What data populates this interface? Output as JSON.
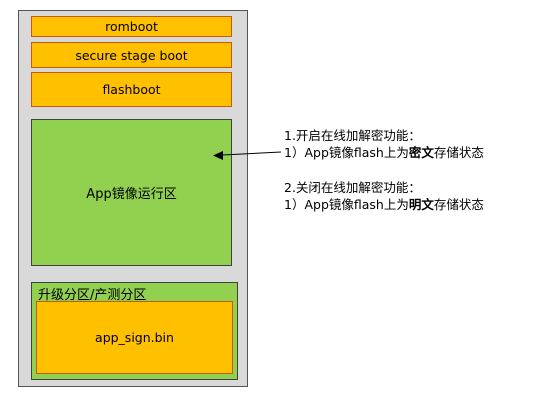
{
  "flash_layout": {
    "romboot": "romboot",
    "secure_stage_boot": "secure stage boot",
    "flashboot": "flashboot",
    "app_region": "App镜像运行区",
    "upgrade_region": "升级分区/产测分区",
    "app_sign": "app_sign.bin"
  },
  "notes": [
    {
      "title": "1.开启在线加解密功能：",
      "detail_prefix": "1）App镜像flash上为",
      "detail_emphasis": "密文",
      "detail_suffix": "存储状态"
    },
    {
      "title": "2.关闭在线加解密功能：",
      "detail_prefix": "1）App镜像flash上为",
      "detail_emphasis": "明文",
      "detail_suffix": "存储状态"
    }
  ],
  "colors": {
    "boot_block": "#ffc000",
    "app_block": "#92d050",
    "frame": "#d9d9d9"
  }
}
